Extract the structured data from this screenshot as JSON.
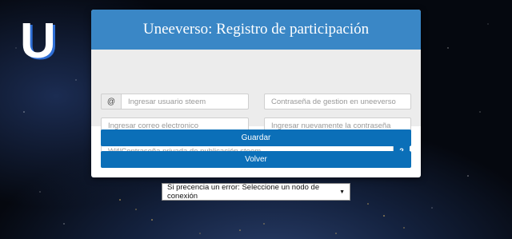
{
  "logo": {
    "letter": "U"
  },
  "form": {
    "title": "Uneeverso: Registro de participación",
    "username": {
      "addon": "@",
      "placeholder": "Ingresar usuario steem"
    },
    "password": {
      "placeholder": "Contraseña de gestion en uneeverso"
    },
    "email": {
      "placeholder": "Ingresar correo electronico"
    },
    "password_repeat": {
      "placeholder": "Ingresar nuevamente la contraseña"
    },
    "wif": {
      "placeholder": "Wif/Contraseña privada de publicación steem"
    },
    "help_label": "?",
    "save_label": "Guardar",
    "back_label": "Volver"
  },
  "node_select": {
    "selected": "Si precencia un error: Seleccione un nodo de conexión"
  },
  "colors": {
    "accent": "#3a87c6",
    "button": "#0b6fb8",
    "logo_fill": "#ffffff",
    "logo_shadow": "#2f6fd6"
  }
}
